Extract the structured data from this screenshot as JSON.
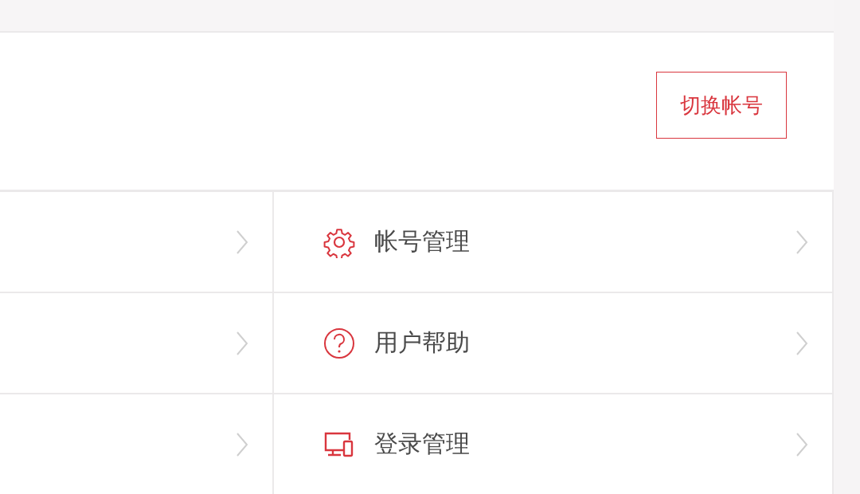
{
  "header": {
    "switch_account_button": "切换帐号"
  },
  "menu": [
    {
      "kind": "gear",
      "label": "帐号管理"
    },
    {
      "kind": "help",
      "label": "用户帮助"
    },
    {
      "kind": "devices",
      "label": "登录管理"
    }
  ]
}
